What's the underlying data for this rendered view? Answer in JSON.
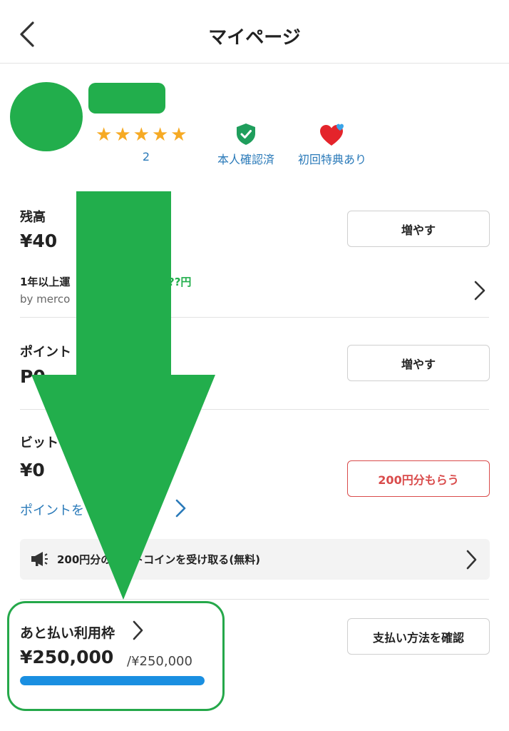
{
  "header": {
    "title": "マイページ"
  },
  "profile": {
    "rating_count": "2",
    "verified_label": "本人確認済",
    "first_time_label": "初回特典あり"
  },
  "balance": {
    "label": "残高",
    "amount": "¥40",
    "increase_label": "増やす",
    "promo_text": "1年以上運",
    "promo_highlight": "??円",
    "promo_sub": "by merco"
  },
  "points": {
    "label": "ポイント",
    "amount": "P0",
    "increase_label": "増やす"
  },
  "bitcoin": {
    "label": "ビット",
    "amount": "¥0",
    "get_button_label": "200円分もらう",
    "link_text": "ポイントを",
    "link_text_end": "う",
    "banner_text": "200円分のビットコインを受け取る(無料)"
  },
  "postpay": {
    "label": "あと払い利用枠",
    "available": "¥250,000",
    "limit": "/¥250,000",
    "usage_fraction": 1.0,
    "check_button_label": "支払い方法を確認"
  },
  "colors": {
    "accent_green": "#22ae4c",
    "link_blue": "#2a7ab9",
    "star": "#f6aa24",
    "red": "#d94b4b",
    "progress": "#1a8fe1"
  }
}
